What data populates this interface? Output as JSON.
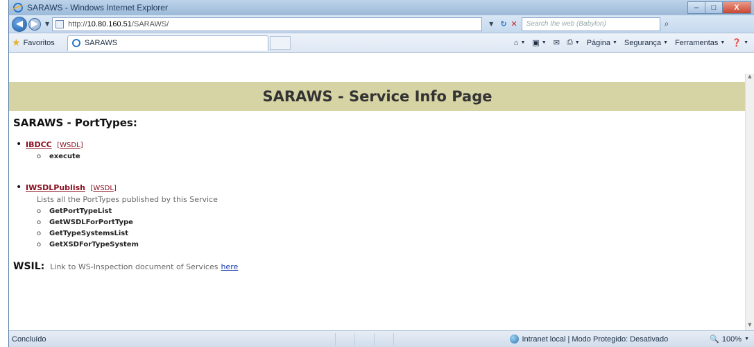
{
  "window": {
    "title": "SARAWS - Windows Internet Explorer",
    "minimize": "–",
    "maximize": "□",
    "close": "X"
  },
  "addressbar": {
    "url_prefix": "http://",
    "url_host": "10.80.160.51",
    "url_path": "/SARAWS/",
    "search_placeholder": "Search the web (Babylon)"
  },
  "favorites": {
    "favorites_label": "Favoritos",
    "tab_title": "SARAWS",
    "commands": [
      "Página",
      "Segurança",
      "Ferramentas"
    ]
  },
  "page": {
    "banner": "SARAWS - Service Info Page",
    "porttypes_heading": "SARAWS - PortTypes:",
    "porttypes": [
      {
        "name": "IBDCC",
        "wsdl": "WSDL",
        "description": "",
        "operations": [
          "execute"
        ]
      },
      {
        "name": "IWSDLPublish",
        "wsdl": "WSDL",
        "description": "Lists all the PortTypes published by this Service",
        "operations": [
          "GetPortTypeList",
          "GetWSDLForPortType",
          "GetTypeSystemsList",
          "GetXSDForTypeSystem"
        ]
      }
    ],
    "wsil_label": "WSIL:",
    "wsil_text": "Link to WS-Inspection document of Services",
    "wsil_link": "here"
  },
  "status": {
    "text": "Concluído",
    "zone": "Intranet local | Modo Protegido: Desativado",
    "zoom": "100%"
  }
}
